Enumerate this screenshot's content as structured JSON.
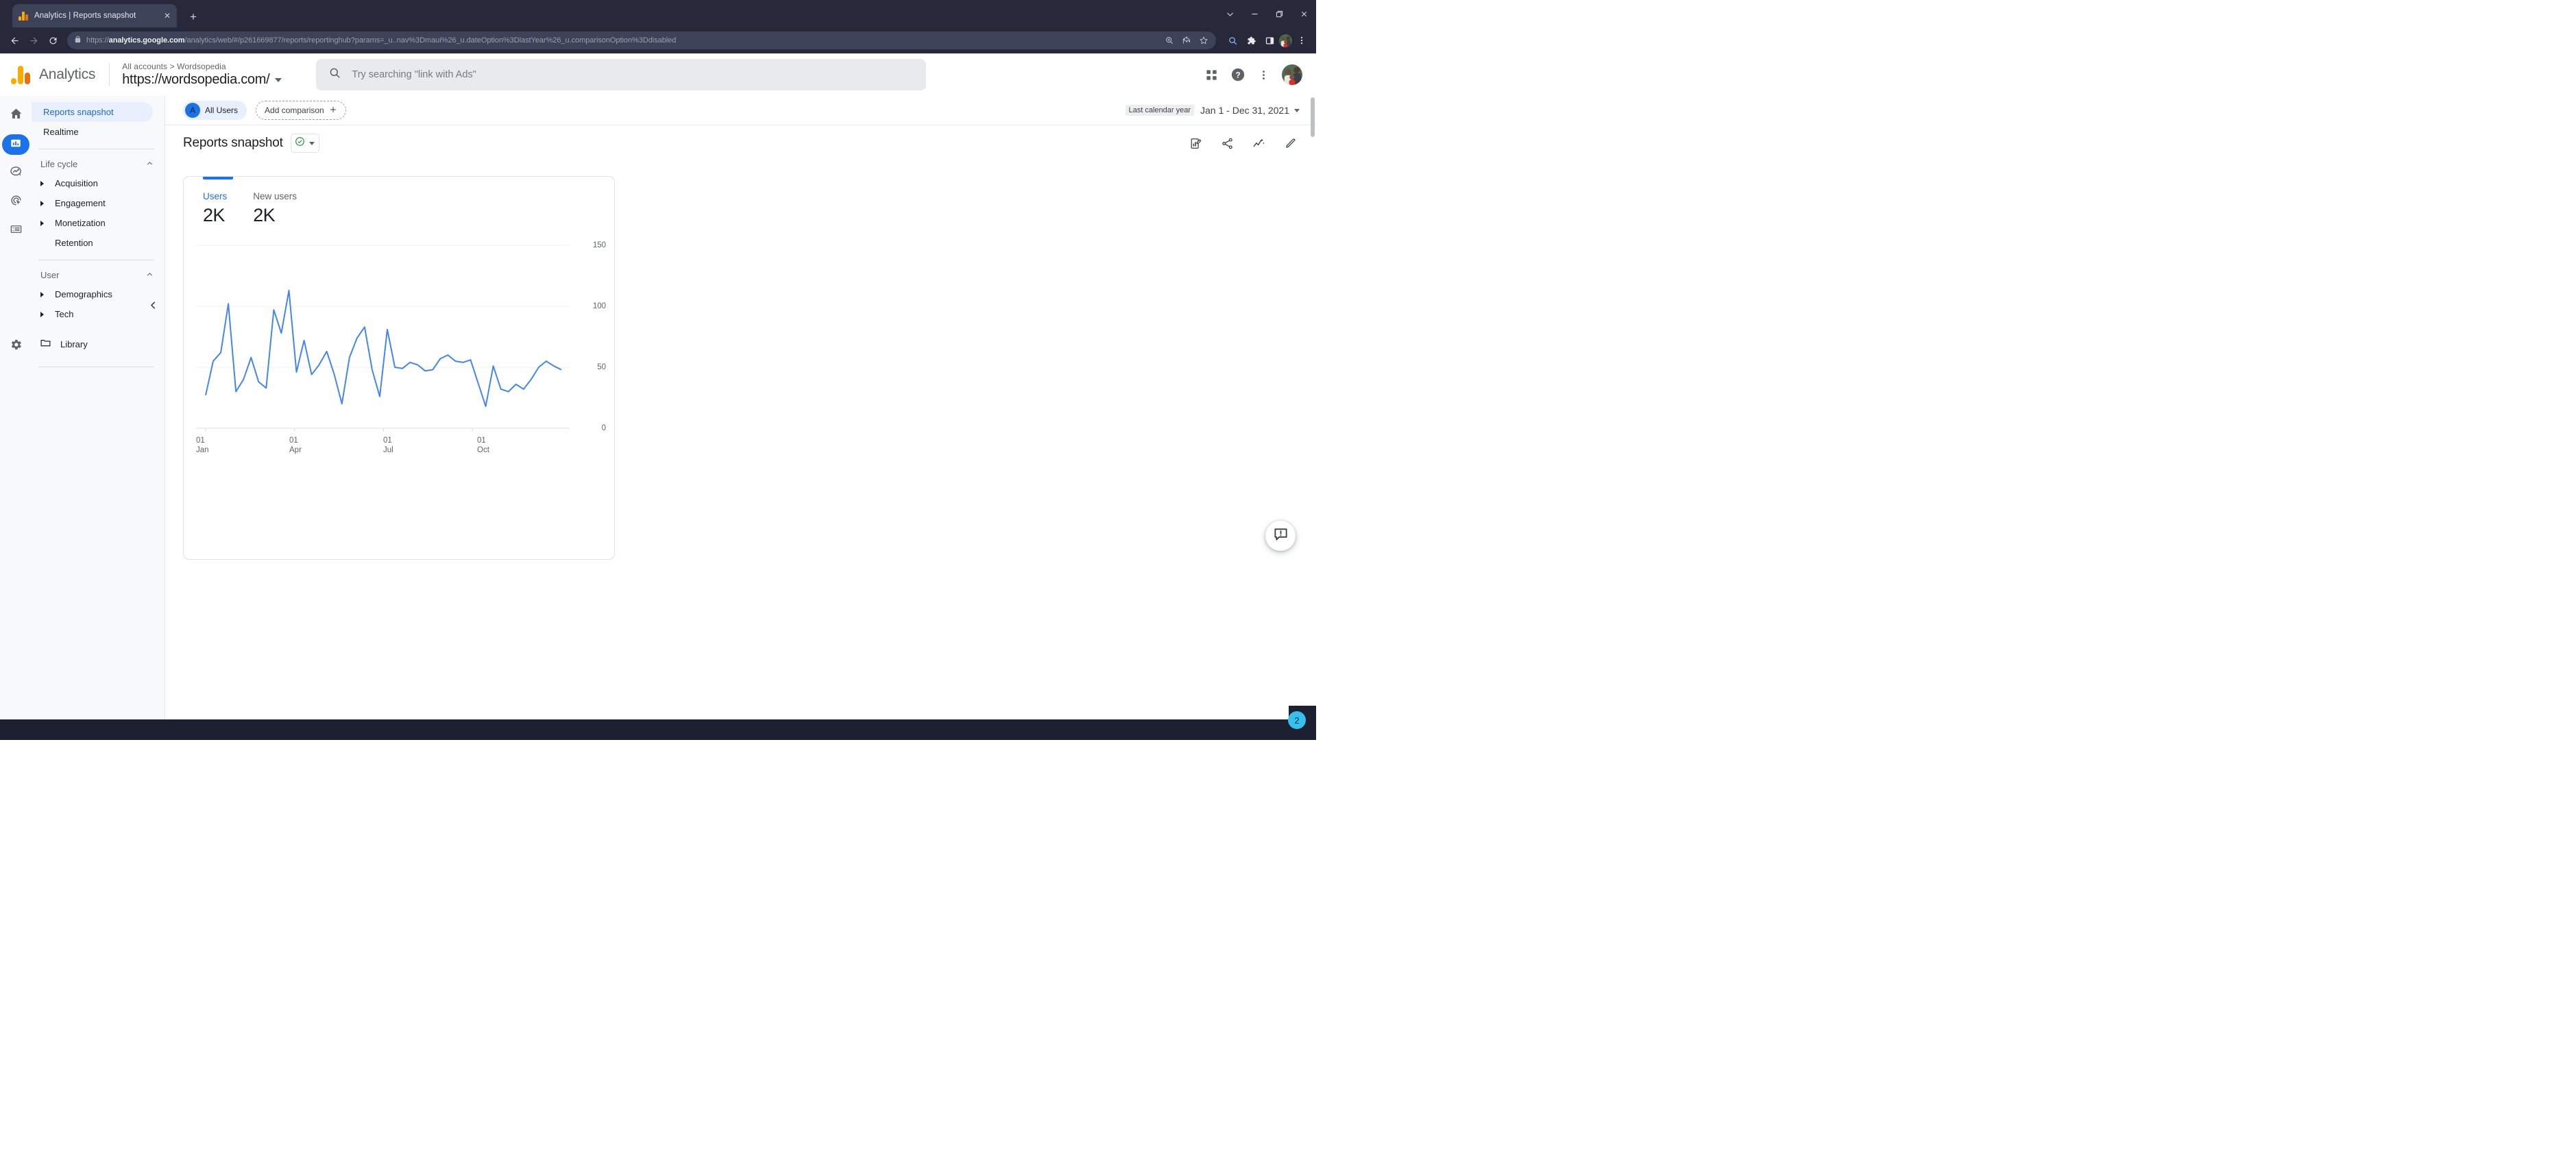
{
  "browser": {
    "tab": {
      "title": "Analytics | Reports snapshot",
      "favicon": "analytics-bars-icon",
      "close_icon": "close-icon"
    },
    "new_tab_label": "+",
    "window_controls": [
      "tab-search-icon",
      "minimize-icon",
      "restore-icon",
      "close-icon"
    ],
    "nav": {
      "back_icon": "back-arrow-icon",
      "forward_icon": "forward-arrow-icon",
      "reload_icon": "reload-icon"
    },
    "omnibox": {
      "lock_icon": "lock-icon",
      "url_prefix": "https://",
      "url_domain": "analytics.google.com",
      "url_path": "/analytics/web/#/p261669877/reports/reportinghub?params=_u..nav%3Dmaui%26_u.dateOption%3DlastYear%26_u.comparisonOption%3Ddisabled",
      "zoom_icon": "zoom-in-icon",
      "share_icon": "share-icon",
      "bookmark_icon": "star-icon"
    },
    "toolbar_right": [
      "search-icon",
      "extensions-puzzle-icon",
      "side-panel-icon",
      "profile-avatar",
      "chrome-menu-icon"
    ]
  },
  "app": {
    "name": "Analytics",
    "logo": "analytics-logo-icon",
    "account": {
      "breadcrumb": "All accounts > Wordsopedia",
      "property": "https://wordsopedia.com/",
      "dropdown_icon": "chevron-down-icon"
    },
    "search": {
      "icon": "search-icon",
      "placeholder": "Try searching \"link with Ads\""
    },
    "header_icons": [
      "apps-grid-icon",
      "help-icon",
      "more-vert-icon",
      "profile-avatar"
    ]
  },
  "rail": {
    "items": [
      {
        "name": "home-icon",
        "active": false
      },
      {
        "name": "reports-bar-chart-icon",
        "active": true
      },
      {
        "name": "explore-icon",
        "active": false
      },
      {
        "name": "advertising-target-icon",
        "active": false
      },
      {
        "name": "configure-list-icon",
        "active": false
      }
    ],
    "settings": {
      "name": "gear-icon"
    }
  },
  "sidebar": {
    "items": [
      {
        "label": "Reports snapshot",
        "selected": true
      },
      {
        "label": "Realtime",
        "selected": false
      }
    ],
    "groups": [
      {
        "label": "Life cycle",
        "collapse_icon": "chevron-up-icon",
        "items": [
          {
            "label": "Acquisition",
            "expandable": true
          },
          {
            "label": "Engagement",
            "expandable": true
          },
          {
            "label": "Monetization",
            "expandable": true
          },
          {
            "label": "Retention",
            "expandable": false
          }
        ]
      },
      {
        "label": "User",
        "collapse_icon": "chevron-up-icon",
        "items": [
          {
            "label": "Demographics",
            "expandable": true
          },
          {
            "label": "Tech",
            "expandable": true
          }
        ]
      }
    ],
    "library": {
      "label": "Library",
      "icon": "folder-icon"
    },
    "collapse_icon": "chevron-left-icon"
  },
  "filterbar": {
    "all_users": {
      "initial": "A",
      "label": "All Users"
    },
    "add_comparison": {
      "label": "Add comparison",
      "icon": "plus-icon"
    },
    "date": {
      "preset_label": "Last calendar year",
      "range": "Jan 1 - Dec 31, 2021",
      "dropdown_icon": "chevron-down-icon"
    }
  },
  "title_row": {
    "title": "Reports snapshot",
    "badge_icon": "check-circle-icon",
    "badge_caret": "chevron-down-icon",
    "actions": [
      "customize-report-icon",
      "share-icon",
      "insights-icon",
      "edit-pencil-icon"
    ]
  },
  "card": {
    "metrics": [
      {
        "name": "Users",
        "value": "2K",
        "active": true
      },
      {
        "name": "New users",
        "value": "2K",
        "active": false
      }
    ]
  },
  "feedback": {
    "icon": "feedback-bubble-icon"
  },
  "overlay": {
    "badge_count": "2"
  },
  "colors": {
    "accent_blue": "#1a73e8",
    "line_blue": "#4285f4",
    "sidebar_bg": "#f8f9fa",
    "selected_bg": "#e8f0fe",
    "browser_chrome": "#27293a",
    "badge_cyan": "#35c1ee"
  },
  "chart_data": {
    "type": "line",
    "title": "Users",
    "xlabel": "",
    "ylabel": "",
    "ylim": [
      0,
      150
    ],
    "yticks": [
      0,
      50,
      100,
      150
    ],
    "grid": true,
    "legend": "none",
    "xtick_labels": [
      {
        "top": "01",
        "bottom": "Jan"
      },
      {
        "top": "01",
        "bottom": "Apr"
      },
      {
        "top": "01",
        "bottom": "Jul"
      },
      {
        "top": "01",
        "bottom": "Oct"
      }
    ],
    "xtick_positions": [
      0,
      25,
      50,
      75
    ],
    "series": [
      {
        "name": "Users",
        "color": "#4285f4",
        "values": [
          27,
          55,
          62,
          102,
          30,
          40,
          58,
          38,
          33,
          97,
          78,
          113,
          46,
          72,
          44,
          52,
          63,
          44,
          20,
          58,
          74,
          83,
          48,
          26,
          81,
          50,
          49,
          54,
          52,
          47,
          48,
          57,
          60,
          55,
          54,
          56,
          37,
          18,
          51,
          32,
          30,
          36,
          32,
          40,
          50,
          55,
          51,
          48
        ]
      }
    ]
  }
}
